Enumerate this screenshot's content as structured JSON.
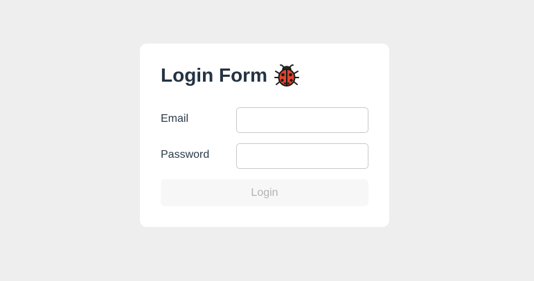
{
  "colors": {
    "page_background": "#eeeeee",
    "card_background": "#ffffff",
    "title_text": "#243342",
    "button_background_disabled": "#f7f7f7",
    "button_text_disabled": "#b3b3b3",
    "ladybug_red": "#e0452b"
  },
  "form": {
    "title": "Login Form",
    "title_icon": "ladybug-icon",
    "email": {
      "label": "Email",
      "value": "",
      "placeholder": ""
    },
    "password": {
      "label": "Password",
      "value": "",
      "placeholder": ""
    },
    "submit_label": "Login",
    "submit_disabled": true
  }
}
